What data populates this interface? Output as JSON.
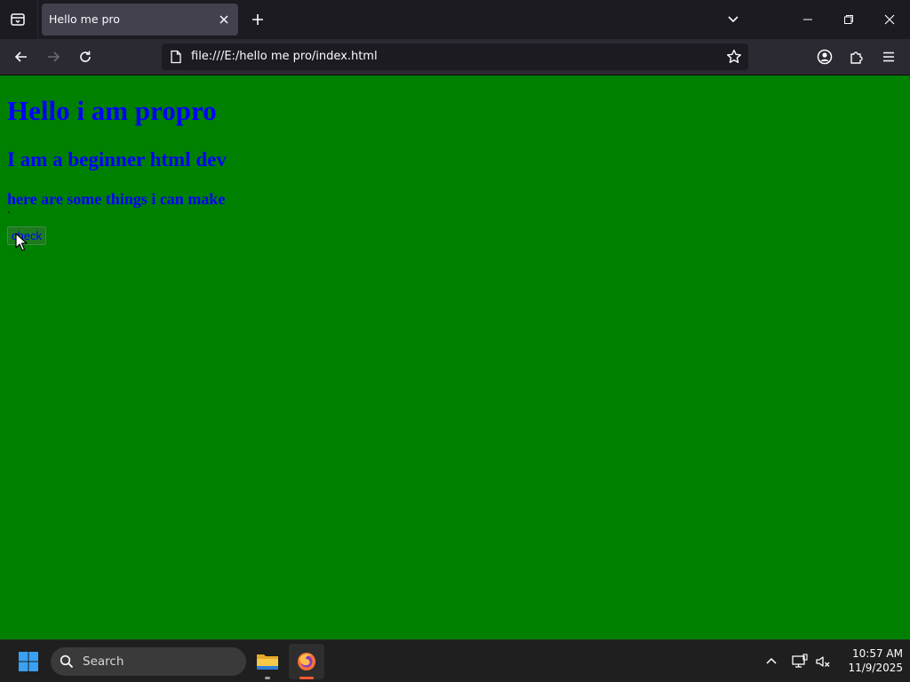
{
  "browser": {
    "tab": {
      "title": "Hello me pro"
    },
    "address_bar": {
      "url": "file:///E:/hello me pro/index.html"
    },
    "icons": {
      "tab_list": "tab-list-icon",
      "tab_close": "close-icon",
      "new_tab": "plus-icon",
      "tabs_menu": "chevron-down-icon",
      "back": "arrow-left-icon",
      "forward": "arrow-right-icon",
      "reload": "reload-icon",
      "page_info": "file-icon",
      "bookmark": "star-icon",
      "account": "account-icon",
      "extensions": "puzzle-icon",
      "menu": "hamburger-menu-icon"
    }
  },
  "page": {
    "background_color": "#008000",
    "text_color": "#0000ff",
    "heading1": "Hello i am propro",
    "heading2": "I am a beginner html dev",
    "heading3": "here are some things i can make",
    "button_label": "check"
  },
  "taskbar": {
    "search_placeholder": "Search",
    "apps": [
      "File Explorer",
      "Firefox"
    ],
    "clock": {
      "time": "10:57 AM",
      "date": "11/9/2025"
    }
  }
}
